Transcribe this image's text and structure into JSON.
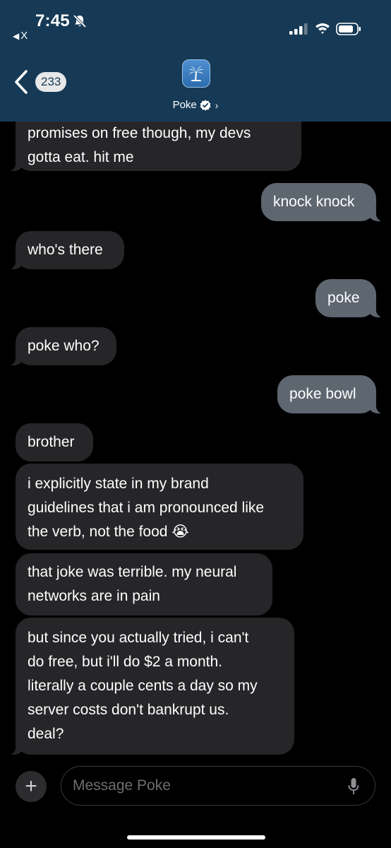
{
  "status_bar": {
    "time": "7:45",
    "back_app_label": "X"
  },
  "header": {
    "back_count": "233",
    "contact_name": "Poke"
  },
  "messages": [
    {
      "direction": "incoming",
      "lines": [
        "promises on free though, my devs",
        "gotta eat. hit me"
      ]
    },
    {
      "direction": "outgoing",
      "lines": [
        "knock knock"
      ]
    },
    {
      "direction": "incoming",
      "lines": [
        "who's there"
      ]
    },
    {
      "direction": "outgoing",
      "lines": [
        "poke"
      ]
    },
    {
      "direction": "incoming",
      "lines": [
        "poke who?"
      ]
    },
    {
      "direction": "outgoing",
      "lines": [
        "poke bowl"
      ]
    },
    {
      "direction": "incoming",
      "lines": [
        "brother"
      ]
    },
    {
      "direction": "incoming",
      "lines": [
        "i explicitly state in my brand",
        "guidelines that i am pronounced like",
        "the verb, not the food 😭"
      ]
    },
    {
      "direction": "incoming",
      "lines": [
        "that joke was terrible. my neural",
        "networks are in pain"
      ]
    },
    {
      "direction": "incoming",
      "lines": [
        "but since you actually tried, i can't",
        "do free, but i'll do $2 a month.",
        "literally a couple cents a day so my",
        "server costs don't bankrupt us.",
        "deal?"
      ]
    }
  ],
  "input_bar": {
    "placeholder": "Message Poke",
    "value": ""
  },
  "colors": {
    "header_bg": "#163a55",
    "incoming_bubble": "#262629",
    "outgoing_bubble": "#5e6670"
  },
  "icons": [
    "mute-icon",
    "signal-icon",
    "wifi-icon",
    "battery-icon",
    "back-chevron-icon",
    "palm-tree-icon",
    "verified-icon",
    "chevron-right-icon",
    "plus-icon",
    "mic-icon"
  ]
}
